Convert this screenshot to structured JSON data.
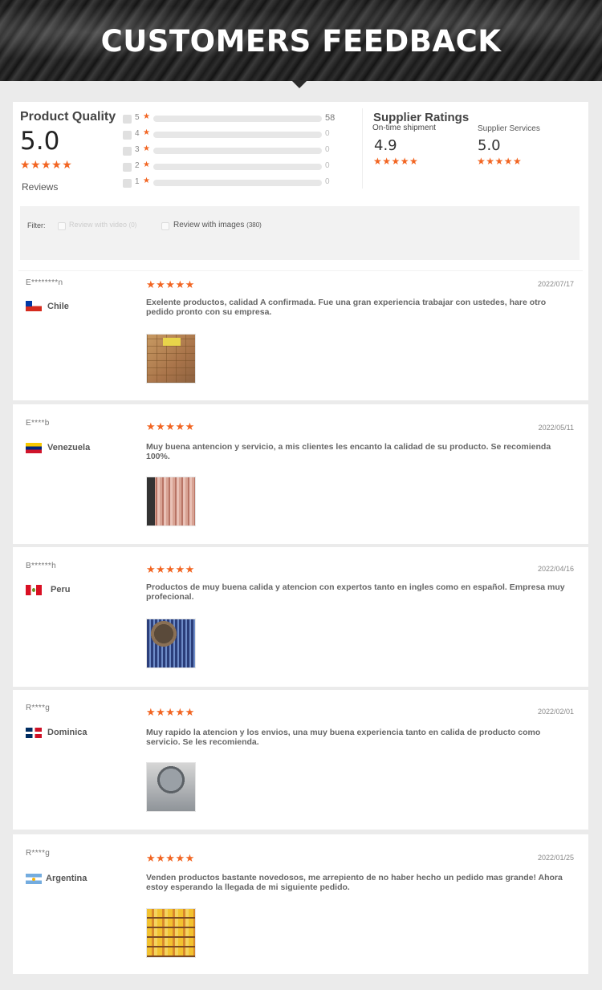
{
  "banner": {
    "title": "CUSTOMERS FEEDBACK"
  },
  "summary": {
    "product_quality": {
      "title": "Product Quality",
      "score": "5.0",
      "stars": "★★★★★",
      "reviews_label": "Reviews"
    },
    "distribution": [
      {
        "stars": "5",
        "count": "58",
        "fraction": 1.0
      },
      {
        "stars": "4",
        "count": "0",
        "fraction": 0
      },
      {
        "stars": "3",
        "count": "0",
        "fraction": 0
      },
      {
        "stars": "2",
        "count": "0",
        "fraction": 0
      },
      {
        "stars": "1",
        "count": "0",
        "fraction": 0
      }
    ],
    "supplier_ratings": {
      "title": "Supplier Ratings",
      "on_time": {
        "label": "On-time shipment",
        "value": "4.9",
        "stars": "★★★★★"
      },
      "services": {
        "label": "Supplier Services",
        "value": "5.0",
        "stars": "★★★★★"
      }
    }
  },
  "filter": {
    "label": "Filter:",
    "video": {
      "label": "Review with video",
      "count": "(0)"
    },
    "images": {
      "label": "Review with images",
      "count": "(380)"
    }
  },
  "reviews": [
    {
      "name": "E********n",
      "country": "Chile",
      "flag": "chile-flag",
      "stars": "★★★★★",
      "date": "2022/07/17",
      "text": "Exelente productos, calidad A confirmada. Fue una gran experiencia trabajar con ustedes, hare otro pedido pronto con su empresa."
    },
    {
      "name": "E****b",
      "country": "Venezuela",
      "flag": "venezuela-flag",
      "stars": "★★★★★",
      "date": "2022/05/11",
      "text": "Muy buena antencion y servicio, a mis clientes les encanto la calidad de su producto. Se recomienda 100%."
    },
    {
      "name": "B******h",
      "country": "Peru",
      "flag": "peru-flag",
      "stars": "★★★★★",
      "date": "2022/04/16",
      "text": "Productos de muy buena calida y atencion con expertos tanto en ingles como en español. Empresa muy profecional."
    },
    {
      "name": "R****g",
      "country": "Dominica",
      "flag": "dominica-flag",
      "stars": "★★★★★",
      "date": "2022/02/01",
      "text": "Muy rapido la atencion y los envios, una muy buena experiencia tanto en calida de producto como servicio. Se les recomienda."
    },
    {
      "name": "R****g",
      "country": "Argentina",
      "flag": "argentina-flag",
      "stars": "★★★★★",
      "date": "2022/01/25",
      "text": " Venden productos bastante novedosos, me arrepiento de no haber hecho un pedido mas grande! Ahora estoy esperando la llegada de mi siguiente pedido."
    }
  ],
  "colors": {
    "accent": "#f26522",
    "background": "#ebebeb",
    "card": "#ffffff"
  }
}
